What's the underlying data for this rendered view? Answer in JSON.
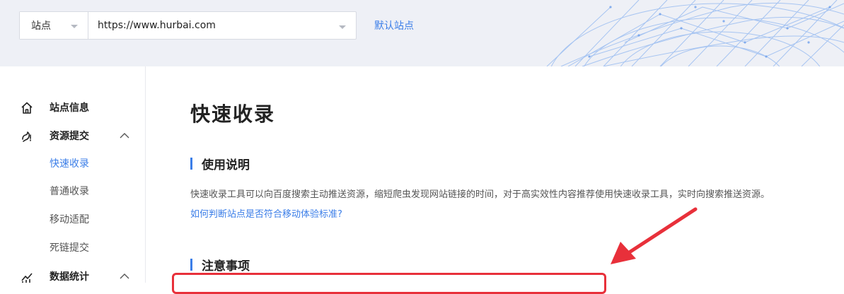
{
  "header": {
    "site_type": "站点",
    "site_url": "https://www.hurbai.com",
    "default_site_label": "默认站点"
  },
  "sidebar": {
    "site_info": "站点信息",
    "resource_submit": "资源提交",
    "sub_items": [
      "快速收录",
      "普通收录",
      "移动适配",
      "死链提交"
    ],
    "data_stats": "数据统计"
  },
  "main": {
    "title": "快速收录",
    "usage_heading": "使用说明",
    "usage_desc": "快速收录工具可以向百度搜索主动推送资源，缩短爬虫发现网站链接的时间，对于高实效性内容推荐使用快速收录工具，实时向搜索推送资源。",
    "help_link": "如何判断站点是否符合移动体验标准?",
    "notes_heading": "注意事项"
  },
  "colors": {
    "accent": "#3b7ee8",
    "annotation_red": "#e8303a",
    "header_bg": "#eef0f6"
  }
}
